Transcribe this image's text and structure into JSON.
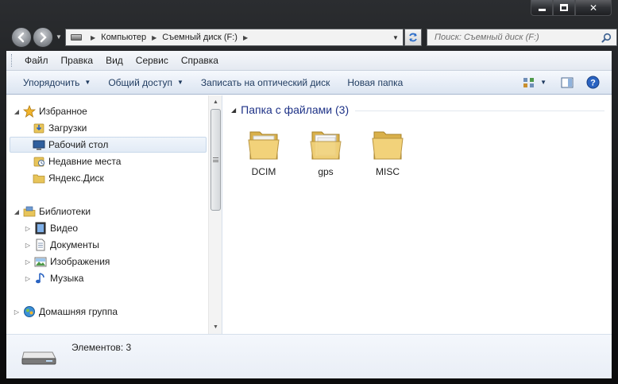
{
  "window": {
    "caption": {
      "minimize": "min",
      "maximize": "max",
      "close": "✕"
    }
  },
  "address": {
    "crumbs": [
      "Компьютер",
      "Съемный диск (F:)"
    ]
  },
  "search": {
    "placeholder": "Поиск: Съемный диск (F:)"
  },
  "menu": [
    "Файл",
    "Правка",
    "Вид",
    "Сервис",
    "Справка"
  ],
  "toolbar": {
    "organize": "Упорядочить",
    "share": "Общий доступ",
    "burn": "Записать на оптический диск",
    "new_folder": "Новая папка"
  },
  "nav": {
    "favorites": "Избранное",
    "downloads": "Загрузки",
    "desktop": "Рабочий стол",
    "recent": "Недавние места",
    "yandex": "Яндекс.Диск",
    "libraries": "Библиотеки",
    "video": "Видео",
    "documents": "Документы",
    "images": "Изображения",
    "music": "Музыка",
    "homegroup": "Домашняя группа"
  },
  "content": {
    "group_title": "Папка с файлами (3)",
    "items": [
      "DCIM",
      "gps",
      "MISC"
    ]
  },
  "details": {
    "count": "Элементов: 3"
  },
  "colors": {
    "group_title": "#1e3287",
    "command_text": "#1e3a5f",
    "folder": "#e8c55a",
    "frame": "#111214"
  }
}
